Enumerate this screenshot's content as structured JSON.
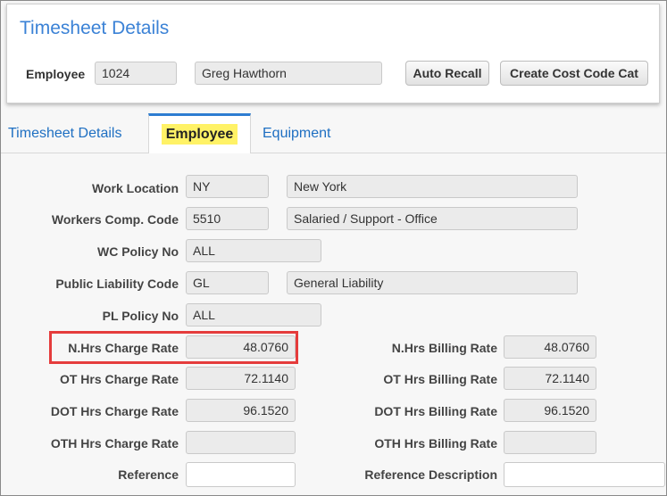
{
  "header": {
    "title": "Timesheet Details",
    "employee_label": "Employee",
    "employee_id": "1024",
    "employee_name": "Greg Hawthorn",
    "auto_recall_label": "Auto Recall",
    "create_cost_code_label": "Create Cost Code Cat"
  },
  "tabs": {
    "timesheet_details": "Timesheet Details",
    "employee": "Employee",
    "equipment": "Equipment"
  },
  "form": {
    "work_location_label": "Work Location",
    "work_location_code": "NY",
    "work_location_name": "New York",
    "workers_comp_label": "Workers Comp. Code",
    "workers_comp_code": "5510",
    "workers_comp_name": "Salaried / Support - Office",
    "wc_policy_label": "WC Policy No",
    "wc_policy_value": "ALL",
    "public_liability_label": "Public Liability Code",
    "public_liability_code": "GL",
    "public_liability_name": "General Liability",
    "pl_policy_label": "PL Policy No",
    "pl_policy_value": "ALL",
    "nhrs_charge_label": "N.Hrs Charge Rate",
    "nhrs_charge_value": "48.0760",
    "ot_charge_label": "OT Hrs Charge Rate",
    "ot_charge_value": "72.1140",
    "dot_charge_label": "DOT Hrs Charge Rate",
    "dot_charge_value": "96.1520",
    "oth_charge_label": "OTH Hrs Charge Rate",
    "oth_charge_value": "",
    "reference_label": "Reference",
    "reference_value": "",
    "nhrs_billing_label": "N.Hrs Billing Rate",
    "nhrs_billing_value": "48.0760",
    "ot_billing_label": "OT Hrs Billing Rate",
    "ot_billing_value": "72.1140",
    "dot_billing_label": "DOT Hrs Billing Rate",
    "dot_billing_value": "96.1520",
    "oth_billing_label": "OTH Hrs Billing Rate",
    "oth_billing_value": "",
    "reference_desc_label": "Reference Description",
    "reference_desc_value": ""
  },
  "colors": {
    "title_blue": "#3b82d6",
    "tab_link": "#1e6fc2",
    "tab_highlight": "#fff266",
    "callout_red": "#e53c3c"
  }
}
